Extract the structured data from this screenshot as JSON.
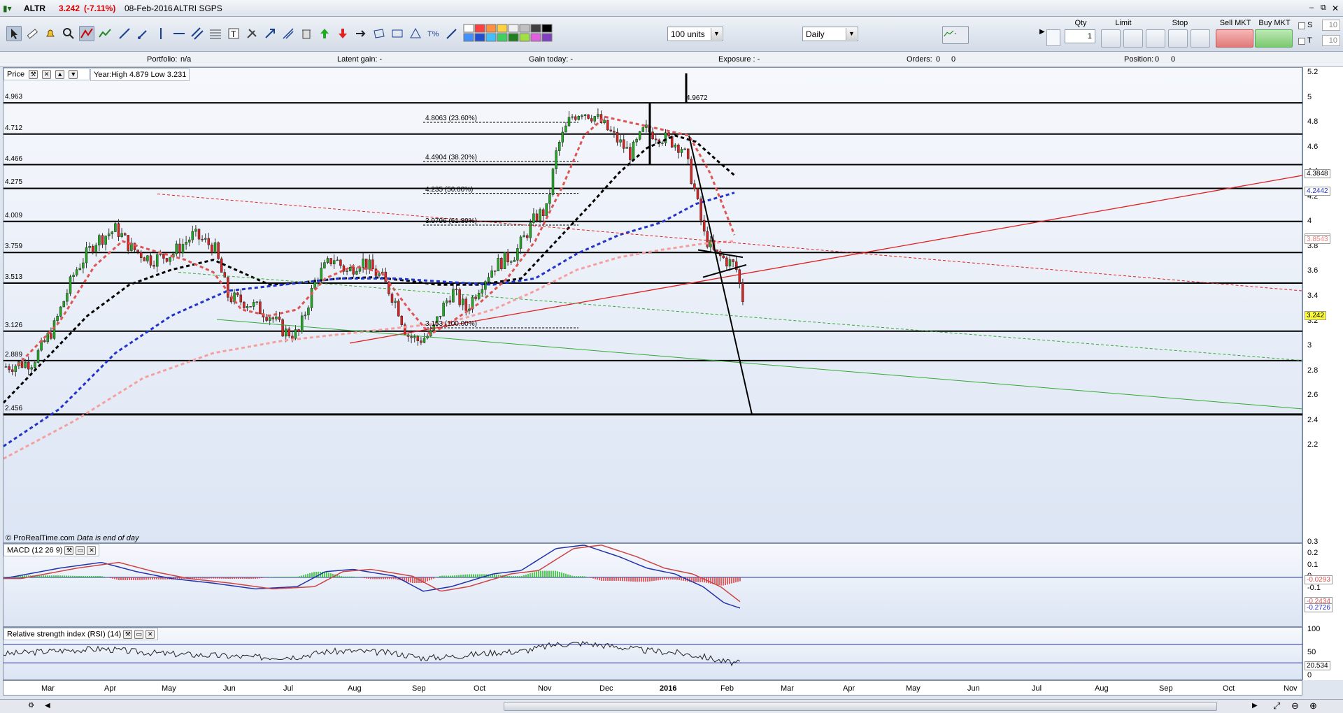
{
  "window": {
    "ticker": "ALTR",
    "price": "3.242",
    "change": "(-7.11%)",
    "date": "08-Feb-2016",
    "name": "ALTRI SGPS"
  },
  "toolbar": {
    "units": "100 units",
    "period": "Daily",
    "qty_label": "Qty",
    "qty_value": "1",
    "limit_label": "Limit",
    "stop_label": "Stop",
    "sell_label": "Sell MKT",
    "buy_label": "Buy MKT",
    "s_label": "S",
    "t_label": "T",
    "s_value": "10",
    "t_value": "10"
  },
  "infobar": {
    "portfolio": "Portfolio:",
    "portfolio_val": "n/a",
    "latent": "Latent gain:  -",
    "gain": "Gain today:  -",
    "exposure": "Exposure :  -",
    "orders": "Orders:",
    "orders_val": "0",
    "orders_val2": "0",
    "position": "Position:",
    "position_val": "0",
    "position_val2": "0"
  },
  "price_panel": {
    "label": "Price",
    "yearinfo": "Year:High 4.879 Low 3.231",
    "credit": "© ProRealTime.com",
    "credit_note": "Data is end of day",
    "hlines": [
      "4.963",
      "4.712",
      "4.466",
      "4.275",
      "4.009",
      "3.759",
      "3.513",
      "3.126",
      "2.889",
      "2.456"
    ],
    "hline_label_below": "4.9672",
    "fib": [
      "4.8063 (23.60%)",
      "4.4904 (38.20%)",
      "4.235 (50.00%)",
      "3.9796 (61.80%)",
      "3.153 (100.00%)"
    ],
    "axis": [
      "5.2",
      "5",
      "4.8",
      "4.6",
      "4.4",
      "4.2",
      "4",
      "3.8",
      "3.6",
      "3.4",
      "3.2",
      "3",
      "2.8",
      "2.6",
      "2.4",
      "2.2"
    ],
    "tags": [
      {
        "v": "4.3848",
        "c": "#000000"
      },
      {
        "v": "4.2442",
        "c": "#2233cc"
      },
      {
        "v": "3.8658",
        "c": "#d9534f"
      },
      {
        "v": "3.8543",
        "c": "#f08080"
      },
      {
        "v": "3.242",
        "c": "#000000",
        "bg": "#ffff33"
      }
    ]
  },
  "macd_panel": {
    "label": "MACD (12 26 9)",
    "axis": [
      "0.3",
      "0.2",
      "0.1",
      "0",
      "-0.1"
    ],
    "tags": [
      "-0.0293",
      "-0.2434",
      "-0.2726"
    ]
  },
  "rsi_panel": {
    "label": "Relative strength index (RSI) (14)",
    "axis": [
      "100",
      "50",
      "0"
    ],
    "tag": "20.534"
  },
  "xaxis": {
    "months": [
      "Mar",
      "Apr",
      "May",
      "Jun",
      "Jul",
      "Aug",
      "Sep",
      "Oct",
      "Nov",
      "Dec",
      "2016",
      "Feb",
      "Mar",
      "Apr",
      "May",
      "Jun",
      "Jul",
      "Aug",
      "Sep",
      "Oct",
      "Nov"
    ]
  },
  "colors": {
    "up": "#22aa22",
    "down": "#dd2222",
    "panel_bg": "#e4eaf6",
    "accent": "#1a3f8f"
  }
}
